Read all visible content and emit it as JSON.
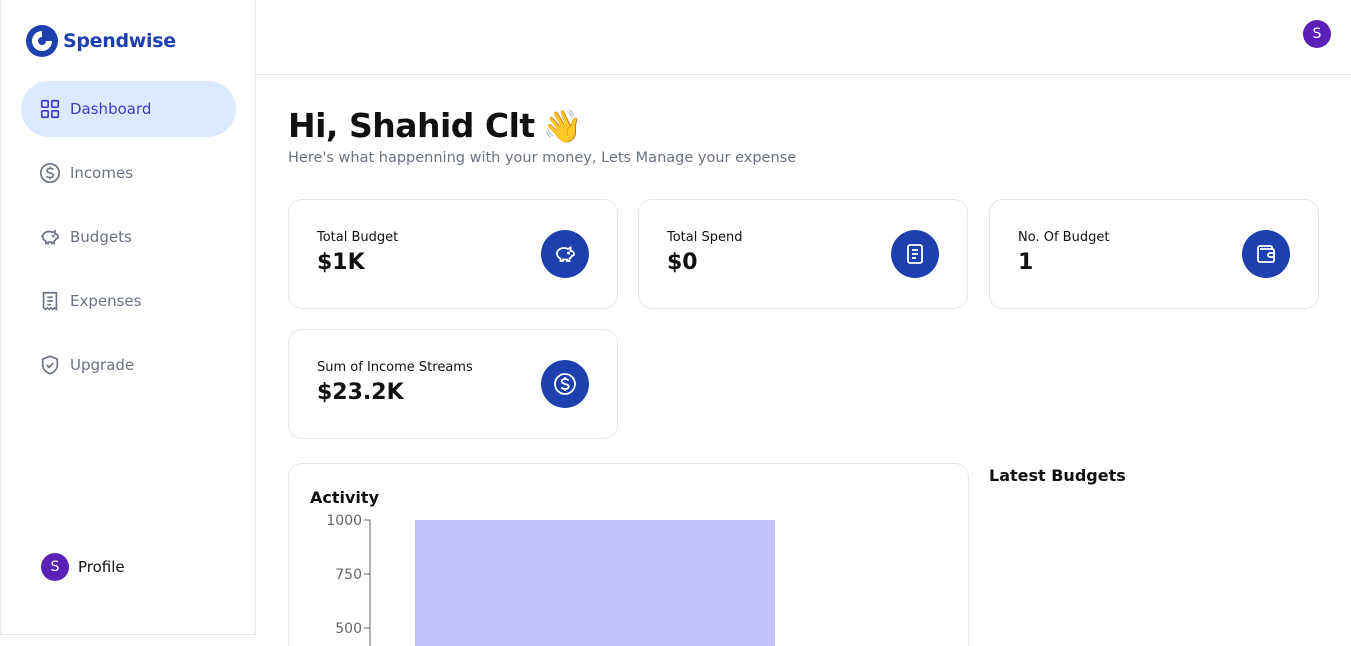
{
  "app": {
    "name": "Spendwise"
  },
  "sidebar": {
    "items": [
      {
        "label": "Dashboard",
        "icon": "dashboard-icon",
        "active": true
      },
      {
        "label": "Incomes",
        "icon": "dollar-circle-icon",
        "active": false
      },
      {
        "label": "Budgets",
        "icon": "piggy-bank-icon",
        "active": false
      },
      {
        "label": "Expenses",
        "icon": "receipt-icon",
        "active": false
      },
      {
        "label": "Upgrade",
        "icon": "shield-check-icon",
        "active": false
      }
    ],
    "profile": {
      "initial": "S",
      "label": "Profile"
    }
  },
  "header": {
    "avatar_initial": "S"
  },
  "main": {
    "greeting": "Hi, Shahid Clt",
    "greeting_emoji": "👋",
    "subtitle": "Here's what happenning with your money, Lets Manage your expense",
    "cards": [
      {
        "label": "Total Budget",
        "value": "$1K",
        "icon": "piggy-bank-icon"
      },
      {
        "label": "Total Spend",
        "value": "$0",
        "icon": "receipt-icon"
      },
      {
        "label": "No. Of Budget",
        "value": "1",
        "icon": "wallet-icon"
      },
      {
        "label": "Sum of Income Streams",
        "value": "$23.2K",
        "icon": "dollar-circle-icon"
      }
    ],
    "activity_title": "Activity",
    "latest_budgets_title": "Latest Budgets"
  },
  "colors": {
    "brand": "#1e40af",
    "active_nav_bg": "#dbeafe",
    "avatar": "#5b21b6",
    "bar": "#c4c2fc"
  },
  "chart_data": {
    "type": "bar",
    "title": "Activity",
    "categories": [
      ""
    ],
    "series": [
      {
        "values": [
          1000
        ]
      }
    ],
    "yticks": [
      1000,
      750,
      500
    ],
    "ytick_labels": [
      "1000",
      "750",
      "500"
    ],
    "ylim": [
      0,
      1000
    ],
    "grid": false
  }
}
